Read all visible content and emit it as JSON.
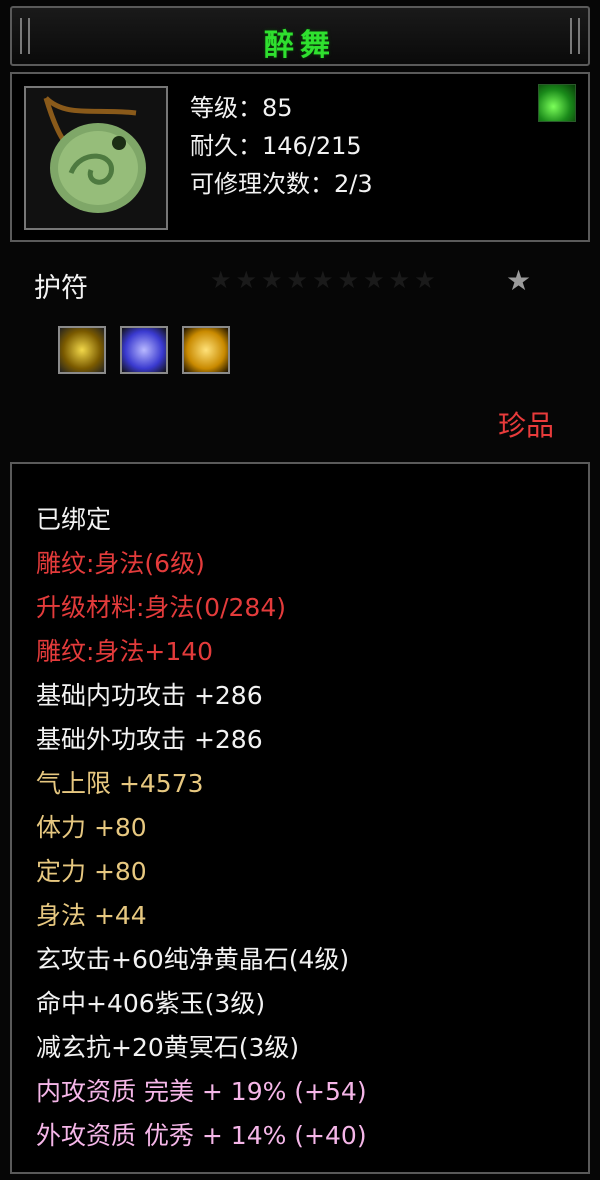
{
  "title": "醉舞",
  "item": {
    "icon": "jade-pendant-icon",
    "level": "等级：85",
    "durability": "耐久：146/215",
    "repairs": "可修理次数：2/3",
    "type_icon": "leaf-icon"
  },
  "category": "护符",
  "stars": {
    "total": 10,
    "filled": 1
  },
  "gems": [
    {
      "icon": "yellow-crystal-gem-icon",
      "color": "#c8a400"
    },
    {
      "icon": "purple-jade-gem-icon",
      "color": "#5a5aff"
    },
    {
      "icon": "gold-gem-icon",
      "color": "#f0c000"
    }
  ],
  "rarity": "珍品",
  "colors": {
    "title": "#2fe02f",
    "red": "#e33b3b",
    "gold": "#e7c880",
    "pink": "#f5b6e8",
    "white": "#f2f2f2"
  },
  "attributes": [
    {
      "text": "已绑定",
      "color": "white"
    },
    {
      "text": "雕纹:身法(6级)",
      "color": "red"
    },
    {
      "text": "升级材料:身法(0/284)",
      "color": "red"
    },
    {
      "text": "雕纹:身法+140",
      "color": "red"
    },
    {
      "text": "基础内功攻击  +286",
      "color": "white"
    },
    {
      "text": "基础外功攻击  +286",
      "color": "white"
    },
    {
      "text": "气上限  +4573",
      "color": "gold"
    },
    {
      "text": "体力  +80",
      "color": "gold"
    },
    {
      "text": "定力  +80",
      "color": "gold"
    },
    {
      "text": "身法  +44",
      "color": "gold"
    },
    {
      "text": "玄攻击+60纯净黄晶石(4级)",
      "color": "white"
    },
    {
      "text": "命中+406紫玉(3级)",
      "color": "white"
    },
    {
      "text": "减玄抗+20黄冥石(3级)",
      "color": "white"
    },
    {
      "text": "内攻资质  完美  + 19% (+54)",
      "color": "pink"
    },
    {
      "text": "外攻资质  优秀  + 14% (+40)",
      "color": "pink"
    }
  ]
}
